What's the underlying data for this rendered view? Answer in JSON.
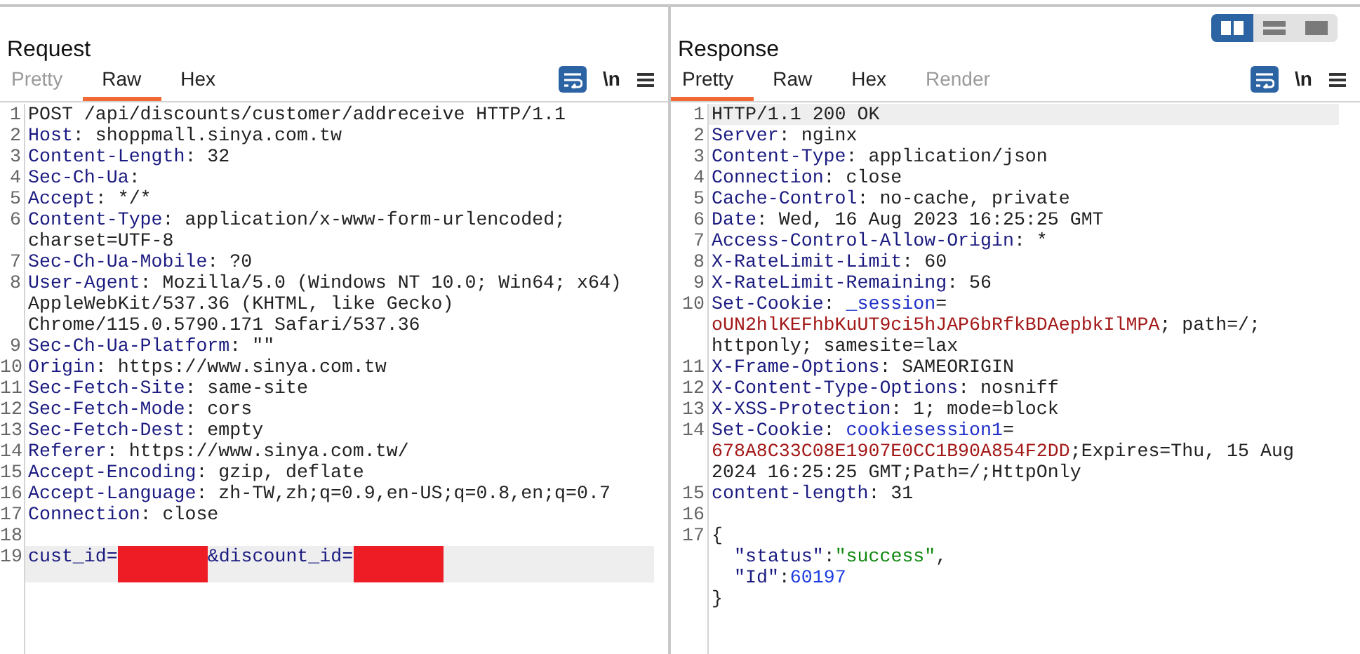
{
  "layout_toggle": [
    {
      "kind": "side-by-side",
      "selected": true
    },
    {
      "kind": "stacked",
      "selected": false
    },
    {
      "kind": "single",
      "selected": false
    }
  ],
  "panels": [
    {
      "title": "Request",
      "tabs": [
        {
          "label": "Pretty",
          "selected": false,
          "disabled": true
        },
        {
          "label": "Raw",
          "selected": true,
          "disabled": false
        },
        {
          "label": "Hex",
          "selected": false,
          "disabled": false
        }
      ],
      "toolbar": {
        "wrap_on": true,
        "newline_label": "\\n"
      },
      "lines": [
        {
          "number": "1",
          "current": false,
          "rows": [
            {
              "segments": [
                {
                  "kind": "plain",
                  "text": "POST /api/discounts/customer/addreceive HTTP/1.1"
                }
              ]
            }
          ]
        },
        {
          "number": "2",
          "current": false,
          "rows": [
            {
              "segments": [
                {
                  "kind": "key",
                  "text": "Host"
                },
                {
                  "kind": "plain",
                  "text": ": shoppmall.sinya.com.tw"
                }
              ]
            }
          ]
        },
        {
          "number": "3",
          "current": false,
          "rows": [
            {
              "segments": [
                {
                  "kind": "key",
                  "text": "Content-Length"
                },
                {
                  "kind": "plain",
                  "text": ": 32"
                }
              ]
            }
          ]
        },
        {
          "number": "4",
          "current": false,
          "rows": [
            {
              "segments": [
                {
                  "kind": "key",
                  "text": "Sec-Ch-Ua"
                },
                {
                  "kind": "plain",
                  "text": ":"
                }
              ]
            }
          ]
        },
        {
          "number": "5",
          "current": false,
          "rows": [
            {
              "segments": [
                {
                  "kind": "key",
                  "text": "Accept"
                },
                {
                  "kind": "plain",
                  "text": ": */*"
                }
              ]
            }
          ]
        },
        {
          "number": "6",
          "current": false,
          "rows": [
            {
              "segments": [
                {
                  "kind": "key",
                  "text": "Content-Type"
                },
                {
                  "kind": "plain",
                  "text": ": application/x-www-form-urlencoded;"
                }
              ]
            },
            {
              "segments": [
                {
                  "kind": "plain",
                  "text": "charset=UTF-8"
                }
              ]
            }
          ]
        },
        {
          "number": "7",
          "current": false,
          "rows": [
            {
              "segments": [
                {
                  "kind": "key",
                  "text": "Sec-Ch-Ua-Mobile"
                },
                {
                  "kind": "plain",
                  "text": ": ?0"
                }
              ]
            }
          ]
        },
        {
          "number": "8",
          "current": false,
          "rows": [
            {
              "segments": [
                {
                  "kind": "key",
                  "text": "User-Agent"
                },
                {
                  "kind": "plain",
                  "text": ": Mozilla/5.0 (Windows NT 10.0; Win64; x64)"
                }
              ]
            },
            {
              "segments": [
                {
                  "kind": "plain",
                  "text": "AppleWebKit/537.36 (KHTML, like Gecko)"
                }
              ]
            },
            {
              "segments": [
                {
                  "kind": "plain",
                  "text": "Chrome/115.0.5790.171 Safari/537.36"
                }
              ]
            }
          ]
        },
        {
          "number": "9",
          "current": false,
          "rows": [
            {
              "segments": [
                {
                  "kind": "key",
                  "text": "Sec-Ch-Ua-Platform"
                },
                {
                  "kind": "plain",
                  "text": ": \"\""
                }
              ]
            }
          ]
        },
        {
          "number": "10",
          "current": false,
          "rows": [
            {
              "segments": [
                {
                  "kind": "key",
                  "text": "Origin"
                },
                {
                  "kind": "plain",
                  "text": ": https://www.sinya.com.tw"
                }
              ]
            }
          ]
        },
        {
          "number": "11",
          "current": false,
          "rows": [
            {
              "segments": [
                {
                  "kind": "key",
                  "text": "Sec-Fetch-Site"
                },
                {
                  "kind": "plain",
                  "text": ": same-site"
                }
              ]
            }
          ]
        },
        {
          "number": "12",
          "current": false,
          "rows": [
            {
              "segments": [
                {
                  "kind": "key",
                  "text": "Sec-Fetch-Mode"
                },
                {
                  "kind": "plain",
                  "text": ": cors"
                }
              ]
            }
          ]
        },
        {
          "number": "13",
          "current": false,
          "rows": [
            {
              "segments": [
                {
                  "kind": "key",
                  "text": "Sec-Fetch-Dest"
                },
                {
                  "kind": "plain",
                  "text": ": empty"
                }
              ]
            }
          ]
        },
        {
          "number": "14",
          "current": false,
          "rows": [
            {
              "segments": [
                {
                  "kind": "key",
                  "text": "Referer"
                },
                {
                  "kind": "plain",
                  "text": ": https://www.sinya.com.tw/"
                }
              ]
            }
          ]
        },
        {
          "number": "15",
          "current": false,
          "rows": [
            {
              "segments": [
                {
                  "kind": "key",
                  "text": "Accept-Encoding"
                },
                {
                  "kind": "plain",
                  "text": ": gzip, deflate"
                }
              ]
            }
          ]
        },
        {
          "number": "16",
          "current": false,
          "rows": [
            {
              "segments": [
                {
                  "kind": "key",
                  "text": "Accept-Language"
                },
                {
                  "kind": "plain",
                  "text": ": zh-TW,zh;q=0.9,en-US;q=0.8,en;q=0.7"
                }
              ]
            }
          ]
        },
        {
          "number": "17",
          "current": false,
          "rows": [
            {
              "segments": [
                {
                  "kind": "key",
                  "text": "Connection"
                },
                {
                  "kind": "plain",
                  "text": ": close"
                }
              ]
            }
          ]
        },
        {
          "number": "18",
          "current": false
        },
        {
          "number": "19",
          "current": true,
          "rows": [
            {
              "segments": [
                {
                  "kind": "key",
                  "text": "cust_id="
                },
                {
                  "kind": "redacted"
                },
                {
                  "kind": "key",
                  "text": "&discount_id="
                },
                {
                  "kind": "redacted"
                }
              ]
            }
          ]
        }
      ]
    },
    {
      "title": "Response",
      "tabs": [
        {
          "label": "Pretty",
          "selected": true,
          "disabled": false
        },
        {
          "label": "Raw",
          "selected": false,
          "disabled": false
        },
        {
          "label": "Hex",
          "selected": false,
          "disabled": false
        },
        {
          "label": "Render",
          "selected": false,
          "disabled": true
        }
      ],
      "toolbar": {
        "wrap_on": true,
        "newline_label": "\\n"
      },
      "lines": [
        {
          "number": "1",
          "current": true,
          "rows": [
            {
              "segments": [
                {
                  "kind": "plain",
                  "text": "HTTP/1.1 200 OK"
                }
              ]
            }
          ]
        },
        {
          "number": "2",
          "current": false,
          "rows": [
            {
              "segments": [
                {
                  "kind": "key",
                  "text": "Server"
                },
                {
                  "kind": "plain",
                  "text": ": nginx"
                }
              ]
            }
          ]
        },
        {
          "number": "3",
          "current": false,
          "rows": [
            {
              "segments": [
                {
                  "kind": "key",
                  "text": "Content-Type"
                },
                {
                  "kind": "plain",
                  "text": ": application/json"
                }
              ]
            }
          ]
        },
        {
          "number": "4",
          "current": false,
          "rows": [
            {
              "segments": [
                {
                  "kind": "key",
                  "text": "Connection"
                },
                {
                  "kind": "plain",
                  "text": ": close"
                }
              ]
            }
          ]
        },
        {
          "number": "5",
          "current": false,
          "rows": [
            {
              "segments": [
                {
                  "kind": "key",
                  "text": "Cache-Control"
                },
                {
                  "kind": "plain",
                  "text": ": no-cache, private"
                }
              ]
            }
          ]
        },
        {
          "number": "6",
          "current": false,
          "rows": [
            {
              "segments": [
                {
                  "kind": "key",
                  "text": "Date"
                },
                {
                  "kind": "plain",
                  "text": ": Wed, 16 Aug 2023 16:25:25 GMT"
                }
              ]
            }
          ]
        },
        {
          "number": "7",
          "current": false,
          "rows": [
            {
              "segments": [
                {
                  "kind": "key",
                  "text": "Access-Control-Allow-Origin"
                },
                {
                  "kind": "plain",
                  "text": ": *"
                }
              ]
            }
          ]
        },
        {
          "number": "8",
          "current": false,
          "rows": [
            {
              "segments": [
                {
                  "kind": "key",
                  "text": "X-RateLimit-Limit"
                },
                {
                  "kind": "plain",
                  "text": ": 60"
                }
              ]
            }
          ]
        },
        {
          "number": "9",
          "current": false,
          "rows": [
            {
              "segments": [
                {
                  "kind": "key",
                  "text": "X-RateLimit-Remaining"
                },
                {
                  "kind": "plain",
                  "text": ": 56"
                }
              ]
            }
          ]
        },
        {
          "number": "10",
          "current": false,
          "rows": [
            {
              "segments": [
                {
                  "kind": "key",
                  "text": "Set-Cookie"
                },
                {
                  "kind": "plain",
                  "text": ": "
                },
                {
                  "kind": "cookie-name",
                  "text": "_session"
                },
                {
                  "kind": "plain",
                  "text": "="
                }
              ]
            },
            {
              "segments": [
                {
                  "kind": "cookie-value",
                  "text": "oUN2hlKEFhbKuUT9ci5hJAP6bRfkBDAepbkIlMPA"
                },
                {
                  "kind": "plain",
                  "text": "; path=/;"
                }
              ]
            },
            {
              "segments": [
                {
                  "kind": "plain",
                  "text": "httponly; samesite=lax"
                }
              ]
            }
          ]
        },
        {
          "number": "11",
          "current": false,
          "rows": [
            {
              "segments": [
                {
                  "kind": "key",
                  "text": "X-Frame-Options"
                },
                {
                  "kind": "plain",
                  "text": ": SAMEORIGIN"
                }
              ]
            }
          ]
        },
        {
          "number": "12",
          "current": false,
          "rows": [
            {
              "segments": [
                {
                  "kind": "key",
                  "text": "X-Content-Type-Options"
                },
                {
                  "kind": "plain",
                  "text": ": nosniff"
                }
              ]
            }
          ]
        },
        {
          "number": "13",
          "current": false,
          "rows": [
            {
              "segments": [
                {
                  "kind": "key",
                  "text": "X-XSS-Protection"
                },
                {
                  "kind": "plain",
                  "text": ": 1; mode=block"
                }
              ]
            }
          ]
        },
        {
          "number": "14",
          "current": false,
          "rows": [
            {
              "segments": [
                {
                  "kind": "key",
                  "text": "Set-Cookie"
                },
                {
                  "kind": "plain",
                  "text": ": "
                },
                {
                  "kind": "cookie-name",
                  "text": "cookiesession1"
                },
                {
                  "kind": "plain",
                  "text": "="
                }
              ]
            },
            {
              "segments": [
                {
                  "kind": "cookie-value",
                  "text": "678A8C33C08E1907E0CC1B90A854F2DD"
                },
                {
                  "kind": "plain",
                  "text": ";Expires=Thu, 15 Aug"
                }
              ]
            },
            {
              "segments": [
                {
                  "kind": "plain",
                  "text": "2024 16:25:25 GMT;Path=/;HttpOnly"
                }
              ]
            }
          ]
        },
        {
          "number": "15",
          "current": false,
          "rows": [
            {
              "segments": [
                {
                  "kind": "key",
                  "text": "content-length"
                },
                {
                  "kind": "plain",
                  "text": ": 31"
                }
              ]
            }
          ]
        },
        {
          "number": "16",
          "current": false
        },
        {
          "number": "17",
          "current": false,
          "rows": [
            {
              "segments": [
                {
                  "kind": "plain",
                  "text": "{"
                }
              ]
            },
            {
              "segments": [
                {
                  "kind": "json-key",
                  "text": "\"status\""
                },
                {
                  "kind": "plain",
                  "text": ":"
                },
                {
                  "kind": "json-string",
                  "text": "\"success\""
                },
                {
                  "kind": "plain",
                  "text": ","
                }
              ]
            },
            {
              "segments": [
                {
                  "kind": "json-key",
                  "text": "\"Id\""
                },
                {
                  "kind": "plain",
                  "text": ":"
                },
                {
                  "kind": "json-number",
                  "text": "60197"
                }
              ]
            },
            {
              "segments": [
                {
                  "kind": "plain",
                  "text": "}"
                }
              ]
            }
          ]
        }
      ]
    }
  ]
}
